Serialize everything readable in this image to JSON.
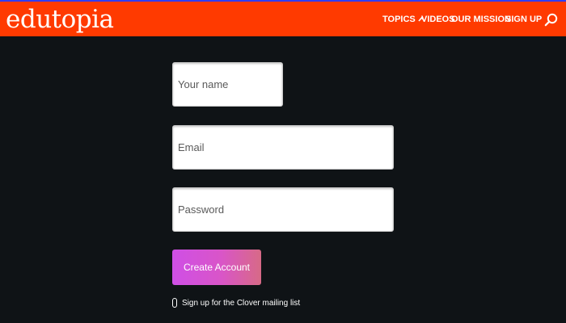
{
  "header": {
    "logo_text": "edutopia",
    "background": "#ff3a00",
    "nav": [
      {
        "label": "TOPICS",
        "icon": "chevron-up-icon"
      },
      {
        "label": "VIDEOS"
      },
      {
        "label": "OUR MISSION"
      },
      {
        "label": "SIGN UP"
      }
    ],
    "search_icon": "search-icon"
  },
  "form": {
    "name_placeholder": "Your name",
    "name_value": "",
    "email_placeholder": "Email",
    "email_value": "",
    "password_placeholder": "Password",
    "password_value": "",
    "submit_label": "Create Account",
    "submit_color": "#d955c8",
    "mailing_list_label": "Sign up for the Clover mailing list",
    "mailing_list_checked": false
  },
  "page_background": "#0f1316"
}
